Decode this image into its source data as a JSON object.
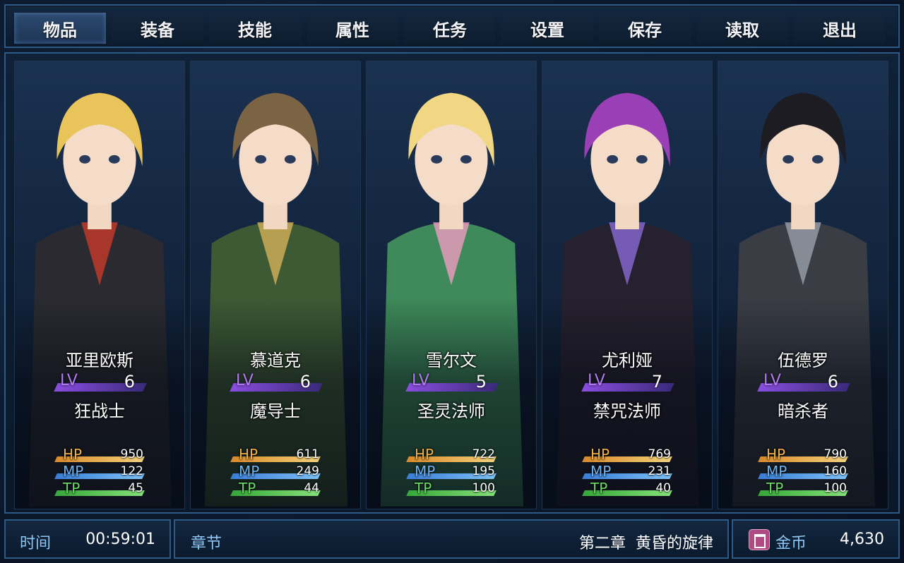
{
  "menu": {
    "items": [
      "物品",
      "装备",
      "技能",
      "属性",
      "任务",
      "设置",
      "保存",
      "读取",
      "退出"
    ],
    "active": "物品"
  },
  "party": [
    {
      "name": "亚里欧斯",
      "lv_label": "LV",
      "lv": "6",
      "class": "狂战士",
      "hp": "950",
      "mp": "122",
      "tp": "45",
      "hair": "#e8c45a",
      "cloth": "#2a2a30",
      "accent": "#c83a2a"
    },
    {
      "name": "慕道克",
      "lv_label": "LV",
      "lv": "6",
      "class": "魔导士",
      "hp": "611",
      "mp": "249",
      "tp": "44",
      "hair": "#7a6444",
      "cloth": "#3d5a34",
      "accent": "#d6b05a"
    },
    {
      "name": "雪尔文",
      "lv_label": "LV",
      "lv": "5",
      "class": "圣灵法师",
      "hp": "722",
      "mp": "195",
      "tp": "100",
      "hair": "#f1d784",
      "cloth": "#3e8a5a",
      "accent": "#f09cc0"
    },
    {
      "name": "尤利娅",
      "lv_label": "LV",
      "lv": "7",
      "class": "禁咒法师",
      "hp": "769",
      "mp": "231",
      "tp": "40",
      "hair": "#9a3fb5",
      "cloth": "#26212e",
      "accent": "#8a6ad6"
    },
    {
      "name": "伍德罗",
      "lv_label": "LV",
      "lv": "6",
      "class": "暗杀者",
      "hp": "790",
      "mp": "160",
      "tp": "100",
      "hair": "#1c1c22",
      "cloth": "#3a3d44",
      "accent": "#9aa0aa"
    }
  ],
  "stat_labels": {
    "hp": "HP",
    "mp": "MP",
    "tp": "TP"
  },
  "status": {
    "time_label": "时间",
    "time": "00:59:01",
    "chapter_label": "章节",
    "chapter": "第二章  黄昏的旋律",
    "gold_label": "金币",
    "gold": "4,630"
  }
}
